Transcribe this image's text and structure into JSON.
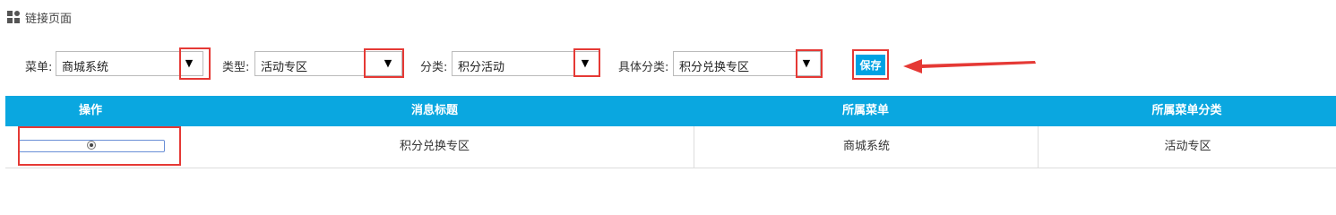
{
  "header": {
    "title": "链接页面",
    "icon": "grid-icon"
  },
  "filters": {
    "menu": {
      "label": "菜单:",
      "value": "商城系统"
    },
    "type": {
      "label": "类型:",
      "value": "活动专区"
    },
    "category": {
      "label": "分类:",
      "value": "积分活动"
    },
    "specific_category": {
      "label": "具体分类:",
      "value": "积分兑换专区"
    },
    "dropdown_arrow": "▼"
  },
  "save_button": {
    "label": "保存"
  },
  "table": {
    "columns": [
      "操作",
      "消息标题",
      "所属菜单",
      "所属菜单分类"
    ],
    "rows": [
      {
        "selected": true,
        "title": "积分兑换专区",
        "menu": "商城系统",
        "menu_category": "活动专区"
      }
    ]
  },
  "colors": {
    "accent": "#0aa7e0",
    "highlight": "#e53935",
    "button": "#00a2e3"
  }
}
